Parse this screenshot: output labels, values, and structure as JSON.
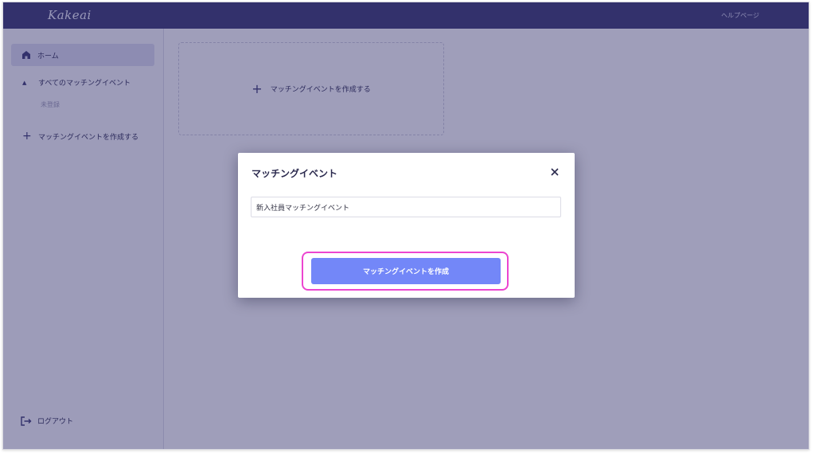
{
  "header": {
    "logo": "Kakeai",
    "help_link": "ヘルプページ"
  },
  "sidebar": {
    "home": "ホーム",
    "all_events": "すべてのマッチングイベント",
    "unregistered": "未登録",
    "create_event": "マッチングイベントを作成する",
    "logout": "ログアウト"
  },
  "main": {
    "create_card_label": "マッチングイベントを作成する"
  },
  "modal": {
    "title": "マッチングイベント",
    "input_value": "新入社員マッチングイベント",
    "submit_label": "マッチングイベントを作成"
  },
  "icons": {
    "home": "home-icon",
    "caret": "caret-up-icon",
    "plus": "plus-icon",
    "logout": "logout-icon",
    "close": "close-icon"
  },
  "colors": {
    "header_bg": "#3b3a72",
    "accent_button": "#7387f8",
    "highlight": "#ec45d0"
  }
}
